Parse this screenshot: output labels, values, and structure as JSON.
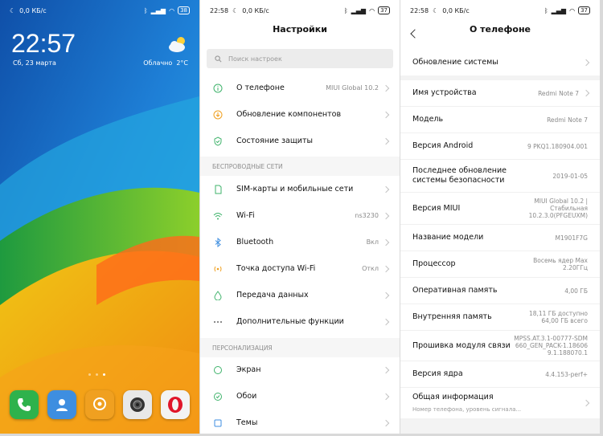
{
  "home": {
    "status": {
      "time": "",
      "net_speed": "0,0 КБ/с",
      "battery": "38"
    },
    "clock": "22:57",
    "date": "Сб, 23 марта",
    "weather": {
      "condition": "Облачно",
      "temp": "2°C"
    },
    "page_count": 3,
    "active_page": 3,
    "dock": [
      {
        "name": "phone",
        "color": "#2eb24c"
      },
      {
        "name": "contacts",
        "color": "#3e8ee0"
      },
      {
        "name": "messages",
        "color": "#f0a020"
      },
      {
        "name": "camera",
        "color": "#e8e8e8"
      },
      {
        "name": "opera",
        "color": "#f3f3f3"
      }
    ]
  },
  "settings": {
    "status": {
      "time": "22:58",
      "net_speed": "0,0 КБ/с",
      "battery": "37"
    },
    "title": "Настройки",
    "search_placeholder": "Поиск настроек",
    "group1": [
      {
        "label": "О телефоне",
        "value": "MIUI Global 10.2",
        "icon": "info-icon"
      },
      {
        "label": "Обновление компонентов",
        "value": "",
        "icon": "update-icon"
      },
      {
        "label": "Состояние защиты",
        "value": "",
        "icon": "shield-icon"
      }
    ],
    "section_wireless": "БЕСПРОВОДНЫЕ СЕТИ",
    "group2": [
      {
        "label": "SIM-карты и мобильные сети",
        "value": "",
        "icon": "sim-icon"
      },
      {
        "label": "Wi-Fi",
        "value": "ns3230",
        "icon": "wifi-icon"
      },
      {
        "label": "Bluetooth",
        "value": "Вкл",
        "icon": "bluetooth-icon"
      },
      {
        "label": "Точка доступа Wi-Fi",
        "value": "Откл",
        "icon": "hotspot-icon"
      },
      {
        "label": "Передача данных",
        "value": "",
        "icon": "data-icon"
      },
      {
        "label": "Дополнительные функции",
        "value": "",
        "icon": "more-icon"
      }
    ],
    "section_personal": "ПЕРСОНАЛИЗАЦИЯ",
    "group3": [
      {
        "label": "Экран",
        "value": "",
        "icon": "display-icon"
      },
      {
        "label": "Обои",
        "value": "",
        "icon": "wallpaper-icon"
      },
      {
        "label": "Темы",
        "value": "",
        "icon": "themes-icon"
      }
    ]
  },
  "about": {
    "status": {
      "time": "22:58",
      "net_speed": "0,0 КБ/с",
      "battery": "37"
    },
    "title": "О телефоне",
    "update": "Обновление системы",
    "rows": [
      {
        "label": "Имя устройства",
        "value": "Redmi Note 7"
      },
      {
        "label": "Модель",
        "value": "Redmi Note 7"
      },
      {
        "label": "Версия Android",
        "value": "9 PKQ1.180904.001"
      },
      {
        "label": "Последнее обновление системы безопасности",
        "value": "2019-01-05"
      },
      {
        "label": "Версия MIUI",
        "value": "MIUI Global 10.2 | Стабильная 10.2.3.0(PFGEUXM)"
      },
      {
        "label": "Название модели",
        "value": "M1901F7G"
      },
      {
        "label": "Процессор",
        "value": "Восемь ядер Max 2.20ГГц"
      },
      {
        "label": "Оперативная память",
        "value": "4,00 ГБ"
      },
      {
        "label": "Внутренняя память",
        "value": "18,11 ГБ доступно 64,00 ГБ всего"
      },
      {
        "label": "Прошивка модуля связи",
        "value": "MPSS.AT.3.1-00777-SDM660_GEN_PACK-1.186069.1.188070.1"
      },
      {
        "label": "Версия ядра",
        "value": "4.4.153-perf+"
      }
    ],
    "general": {
      "label": "Общая информация",
      "sub": "Номер телефона, уровень сигнала..."
    }
  }
}
